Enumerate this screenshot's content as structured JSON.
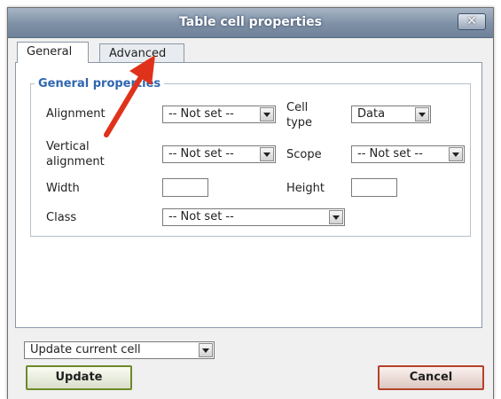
{
  "dialog": {
    "title": "Table cell properties",
    "close_glyph": "✕"
  },
  "tabs": [
    {
      "label": "General",
      "active": true
    },
    {
      "label": "Advanced",
      "active": false
    }
  ],
  "fieldset": {
    "legend": "General properties"
  },
  "fields": {
    "alignment": {
      "label": "Alignment",
      "value": "-- Not set --"
    },
    "cell_type": {
      "label_line1": "Cell",
      "label_line2": "type",
      "value": "Data"
    },
    "vertical_alignment": {
      "label_line1": "Vertical",
      "label_line2": "alignment",
      "value": "-- Not set --"
    },
    "scope": {
      "label": "Scope",
      "value": "-- Not set --"
    },
    "width": {
      "label": "Width",
      "value": ""
    },
    "height": {
      "label": "Height",
      "value": ""
    },
    "class": {
      "label": "Class",
      "value": "-- Not set --"
    }
  },
  "update_scope": {
    "value": "Update current cell"
  },
  "buttons": {
    "update": "Update",
    "cancel": "Cancel"
  },
  "colors": {
    "legend": "#2e66b0",
    "annotation_arrow": "#e0321b",
    "update_border": "#6d8a2a",
    "cancel_border": "#b5422b"
  }
}
